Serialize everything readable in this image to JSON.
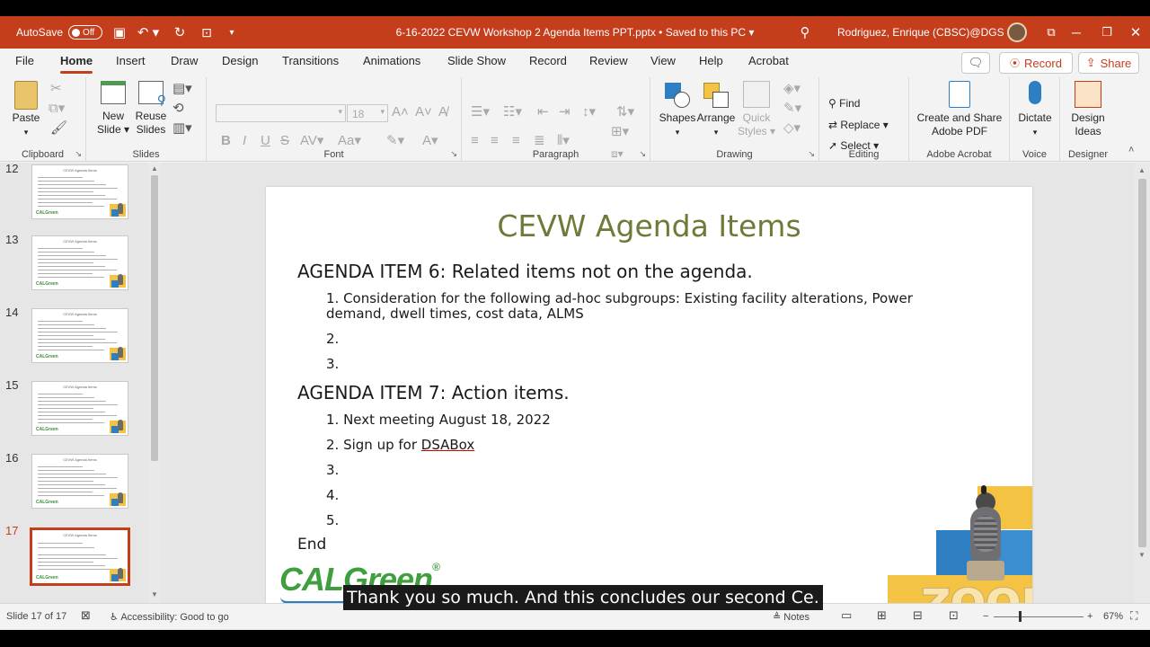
{
  "titlebar": {
    "autosave_label": "AutoSave",
    "autosave_state": "Off",
    "doc_title": "6-16-2022 CEVW Workshop 2 Agenda Items PPT.pptx • Saved to this PC",
    "user": "Rodriguez, Enrique (CBSC)@DGS",
    "accent": "#c43e1c"
  },
  "tabs": [
    "File",
    "Home",
    "Insert",
    "Draw",
    "Design",
    "Transitions",
    "Animations",
    "Slide Show",
    "Record",
    "Review",
    "View",
    "Help",
    "Acrobat"
  ],
  "active_tab": "Home",
  "tab_buttons": {
    "record": "Record",
    "share": "Share"
  },
  "ribbon": {
    "clipboard": {
      "label": "Clipboard",
      "paste": "Paste"
    },
    "slides": {
      "label": "Slides",
      "new_slide": [
        "New",
        "Slide"
      ],
      "reuse_slides": [
        "Reuse",
        "Slides"
      ]
    },
    "font": {
      "label": "Font",
      "font_size": "18",
      "bold": "B",
      "italic": "I",
      "underline": "U",
      "strike": "S"
    },
    "paragraph": {
      "label": "Paragraph"
    },
    "drawing": {
      "label": "Drawing",
      "shapes": "Shapes",
      "arrange": "Arrange",
      "quick_styles": [
        "Quick",
        "Styles"
      ]
    },
    "editing": {
      "label": "Editing",
      "find": "Find",
      "replace": "Replace",
      "select": "Select"
    },
    "adobe": {
      "label": "Adobe Acrobat",
      "create": [
        "Create and Share",
        "Adobe PDF"
      ]
    },
    "voice": {
      "label": "Voice",
      "dictate": "Dictate"
    },
    "designer": {
      "label": "Designer",
      "design_ideas": [
        "Design",
        "Ideas"
      ]
    }
  },
  "thumbnails": [
    {
      "num": "12",
      "title": "CEVW Agenda Items"
    },
    {
      "num": "13",
      "title": "CEVW Agenda Items"
    },
    {
      "num": "14",
      "title": "CEVW Agenda Items"
    },
    {
      "num": "15",
      "title": "CEVW Agenda Items"
    },
    {
      "num": "16",
      "title": "CEVW Agenda Items"
    },
    {
      "num": "17",
      "title": "CEVW Agenda Items",
      "selected": true
    }
  ],
  "slide": {
    "title": "CEVW Agenda Items",
    "item6_heading": "AGENDA ITEM 6: Related items not on the agenda.",
    "item6_list": [
      "1. Consideration for the following ad-hoc subgroups: Existing facility alterations, Power demand, dwell times, cost data, ALMS",
      "2.",
      "3."
    ],
    "item7_heading": "AGENDA ITEM 7: Action items.",
    "item7_list": [
      "1. Next meeting August 18, 2022",
      "2. Sign up for ",
      "3.",
      "4.",
      "5."
    ],
    "item7_link": "DSABox",
    "end": "End",
    "logo_text": "CAL",
    "logo_text2": "Green",
    "logo_mark": "®",
    "title_color": "#6e7a38"
  },
  "watermark": "zoom",
  "caption": "Thank you so much. And this concludes our second Ce.",
  "status": {
    "slide_count": "Slide 17 of 17",
    "accessibility": "Accessibility: Good to go",
    "notes": "Notes",
    "zoom": "67%"
  }
}
